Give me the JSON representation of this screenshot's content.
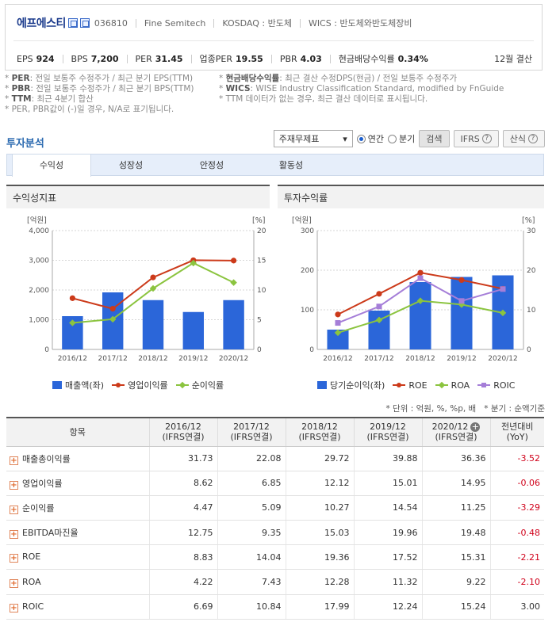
{
  "header": {
    "name": "에프에스티",
    "code": "036810",
    "eng_name": "Fine Semitech",
    "market": "KOSDAQ : 반도체",
    "wics": "WICS : 반도체와반도체장비",
    "metrics": [
      {
        "k": "EPS",
        "v": "924"
      },
      {
        "k": "BPS",
        "v": "7,200"
      },
      {
        "k": "PER",
        "v": "31.45"
      },
      {
        "k": "업종PER",
        "v": "19.55"
      },
      {
        "k": "PBR",
        "v": "4.03"
      },
      {
        "k": "현금배당수익률",
        "v": "0.34%"
      }
    ],
    "fiscal": "12월 결산"
  },
  "notes": {
    "left": [
      {
        "b": "PER",
        "t": ": 전일 보통주 수정주가 / 최근 분기 EPS(TTM)"
      },
      {
        "b": "PBR",
        "t": ": 전일 보통주 수정주가 / 최근 분기 BPS(TTM)"
      },
      {
        "b": "TTM",
        "t": ": 최근 4분기 합산"
      },
      {
        "b": "",
        "t": "PER, PBR값이 (-)일 경우, N/A로 표기됩니다."
      }
    ],
    "right": [
      {
        "b": "현금배당수익률",
        "t": ": 최근 결산 수정DPS(현금) / 전일 보통주 수정주가"
      },
      {
        "b": "WICS",
        "t": ": WISE Industry Classification Standard, modified by FnGuide"
      },
      {
        "b": "",
        "t": "TTM 데이터가 없는 경우, 최근 결산 데이터로 표시됩니다."
      }
    ]
  },
  "section": {
    "title": "투자분석",
    "select_value": "주재무제표",
    "radio_annual": "연간",
    "radio_quarter": "분기",
    "search_btn": "검색",
    "ifrs_btn": "IFRS",
    "formula_btn": "산식"
  },
  "tabs": [
    "수익성",
    "성장성",
    "안정성",
    "활동성"
  ],
  "unit_note_left": "* 단위 : 억원, %, %p, 배",
  "unit_note_right": "* 분기 : 순액기준",
  "chart_data": [
    {
      "type": "bar+line",
      "title": "수익성지표",
      "left_unit": "[억원]",
      "right_unit": "[%]",
      "categories": [
        "2016/12",
        "2017/12",
        "2018/12",
        "2019/12",
        "2020/12"
      ],
      "ylim_left": [
        0,
        4000
      ],
      "yticks_left": [
        "0",
        "1,000",
        "2,000",
        "3,000",
        "4,000"
      ],
      "ylim_right": [
        0,
        20
      ],
      "yticks_right": [
        "0",
        "5",
        "10",
        "15",
        "20"
      ],
      "bars": {
        "name": "매출액(좌)",
        "color": "#2b66d9",
        "values": [
          1120,
          1920,
          1660,
          1260,
          1660
        ]
      },
      "lines": [
        {
          "name": "영업이익률",
          "color": "#cc3a1a",
          "marker": "circle",
          "values": [
            8.62,
            6.85,
            12.12,
            15.01,
            14.95
          ]
        },
        {
          "name": "순이익률",
          "color": "#8bc43f",
          "marker": "diamond",
          "values": [
            4.47,
            5.09,
            10.27,
            14.54,
            11.25
          ]
        }
      ]
    },
    {
      "type": "bar+line",
      "title": "투자수익률",
      "left_unit": "[억원]",
      "right_unit": "[%]",
      "categories": [
        "2016/12",
        "2017/12",
        "2018/12",
        "2019/12",
        "2020/12"
      ],
      "ylim_left": [
        0,
        300
      ],
      "yticks_left": [
        "0",
        "100",
        "200",
        "300"
      ],
      "ylim_right": [
        0,
        30
      ],
      "yticks_right": [
        "0",
        "10",
        "20",
        "30"
      ],
      "bars": {
        "name": "당기순이익(좌)",
        "color": "#2b66d9",
        "values": [
          50,
          98,
          170,
          183,
          187
        ]
      },
      "lines": [
        {
          "name": "ROE",
          "color": "#cc3a1a",
          "marker": "circle",
          "values": [
            8.83,
            14.04,
            19.36,
            17.52,
            15.31
          ]
        },
        {
          "name": "ROA",
          "color": "#8bc43f",
          "marker": "diamond",
          "values": [
            4.22,
            7.43,
            12.28,
            11.32,
            9.22
          ]
        },
        {
          "name": "ROIC",
          "color": "#a57ed8",
          "marker": "square",
          "values": [
            6.69,
            10.84,
            17.99,
            12.24,
            15.24
          ]
        }
      ]
    }
  ],
  "table": {
    "headers": [
      {
        "l1": "항목",
        "l2": ""
      },
      {
        "l1": "2016/12",
        "l2": "(IFRS연결)"
      },
      {
        "l1": "2017/12",
        "l2": "(IFRS연결)"
      },
      {
        "l1": "2018/12",
        "l2": "(IFRS연결)"
      },
      {
        "l1": "2019/12",
        "l2": "(IFRS연결)"
      },
      {
        "l1": "2020/12",
        "l2": "(IFRS연결)"
      },
      {
        "l1": "전년대비",
        "l2": "(YoY)"
      }
    ],
    "rows": [
      {
        "name": "매출총이익률",
        "vals": [
          "31.73",
          "22.08",
          "29.72",
          "39.88",
          "36.36",
          "-3.52"
        ]
      },
      {
        "name": "영업이익률",
        "vals": [
          "8.62",
          "6.85",
          "12.12",
          "15.01",
          "14.95",
          "-0.06"
        ]
      },
      {
        "name": "순이익률",
        "vals": [
          "4.47",
          "5.09",
          "10.27",
          "14.54",
          "11.25",
          "-3.29"
        ]
      },
      {
        "name": "EBITDA마진율",
        "vals": [
          "12.75",
          "9.35",
          "15.03",
          "19.96",
          "19.48",
          "-0.48"
        ]
      },
      {
        "name": "ROE",
        "vals": [
          "8.83",
          "14.04",
          "19.36",
          "17.52",
          "15.31",
          "-2.21"
        ]
      },
      {
        "name": "ROA",
        "vals": [
          "4.22",
          "7.43",
          "12.28",
          "11.32",
          "9.22",
          "-2.10"
        ]
      },
      {
        "name": "ROIC",
        "vals": [
          "6.69",
          "10.84",
          "17.99",
          "12.24",
          "15.24",
          "3.00"
        ]
      }
    ]
  }
}
